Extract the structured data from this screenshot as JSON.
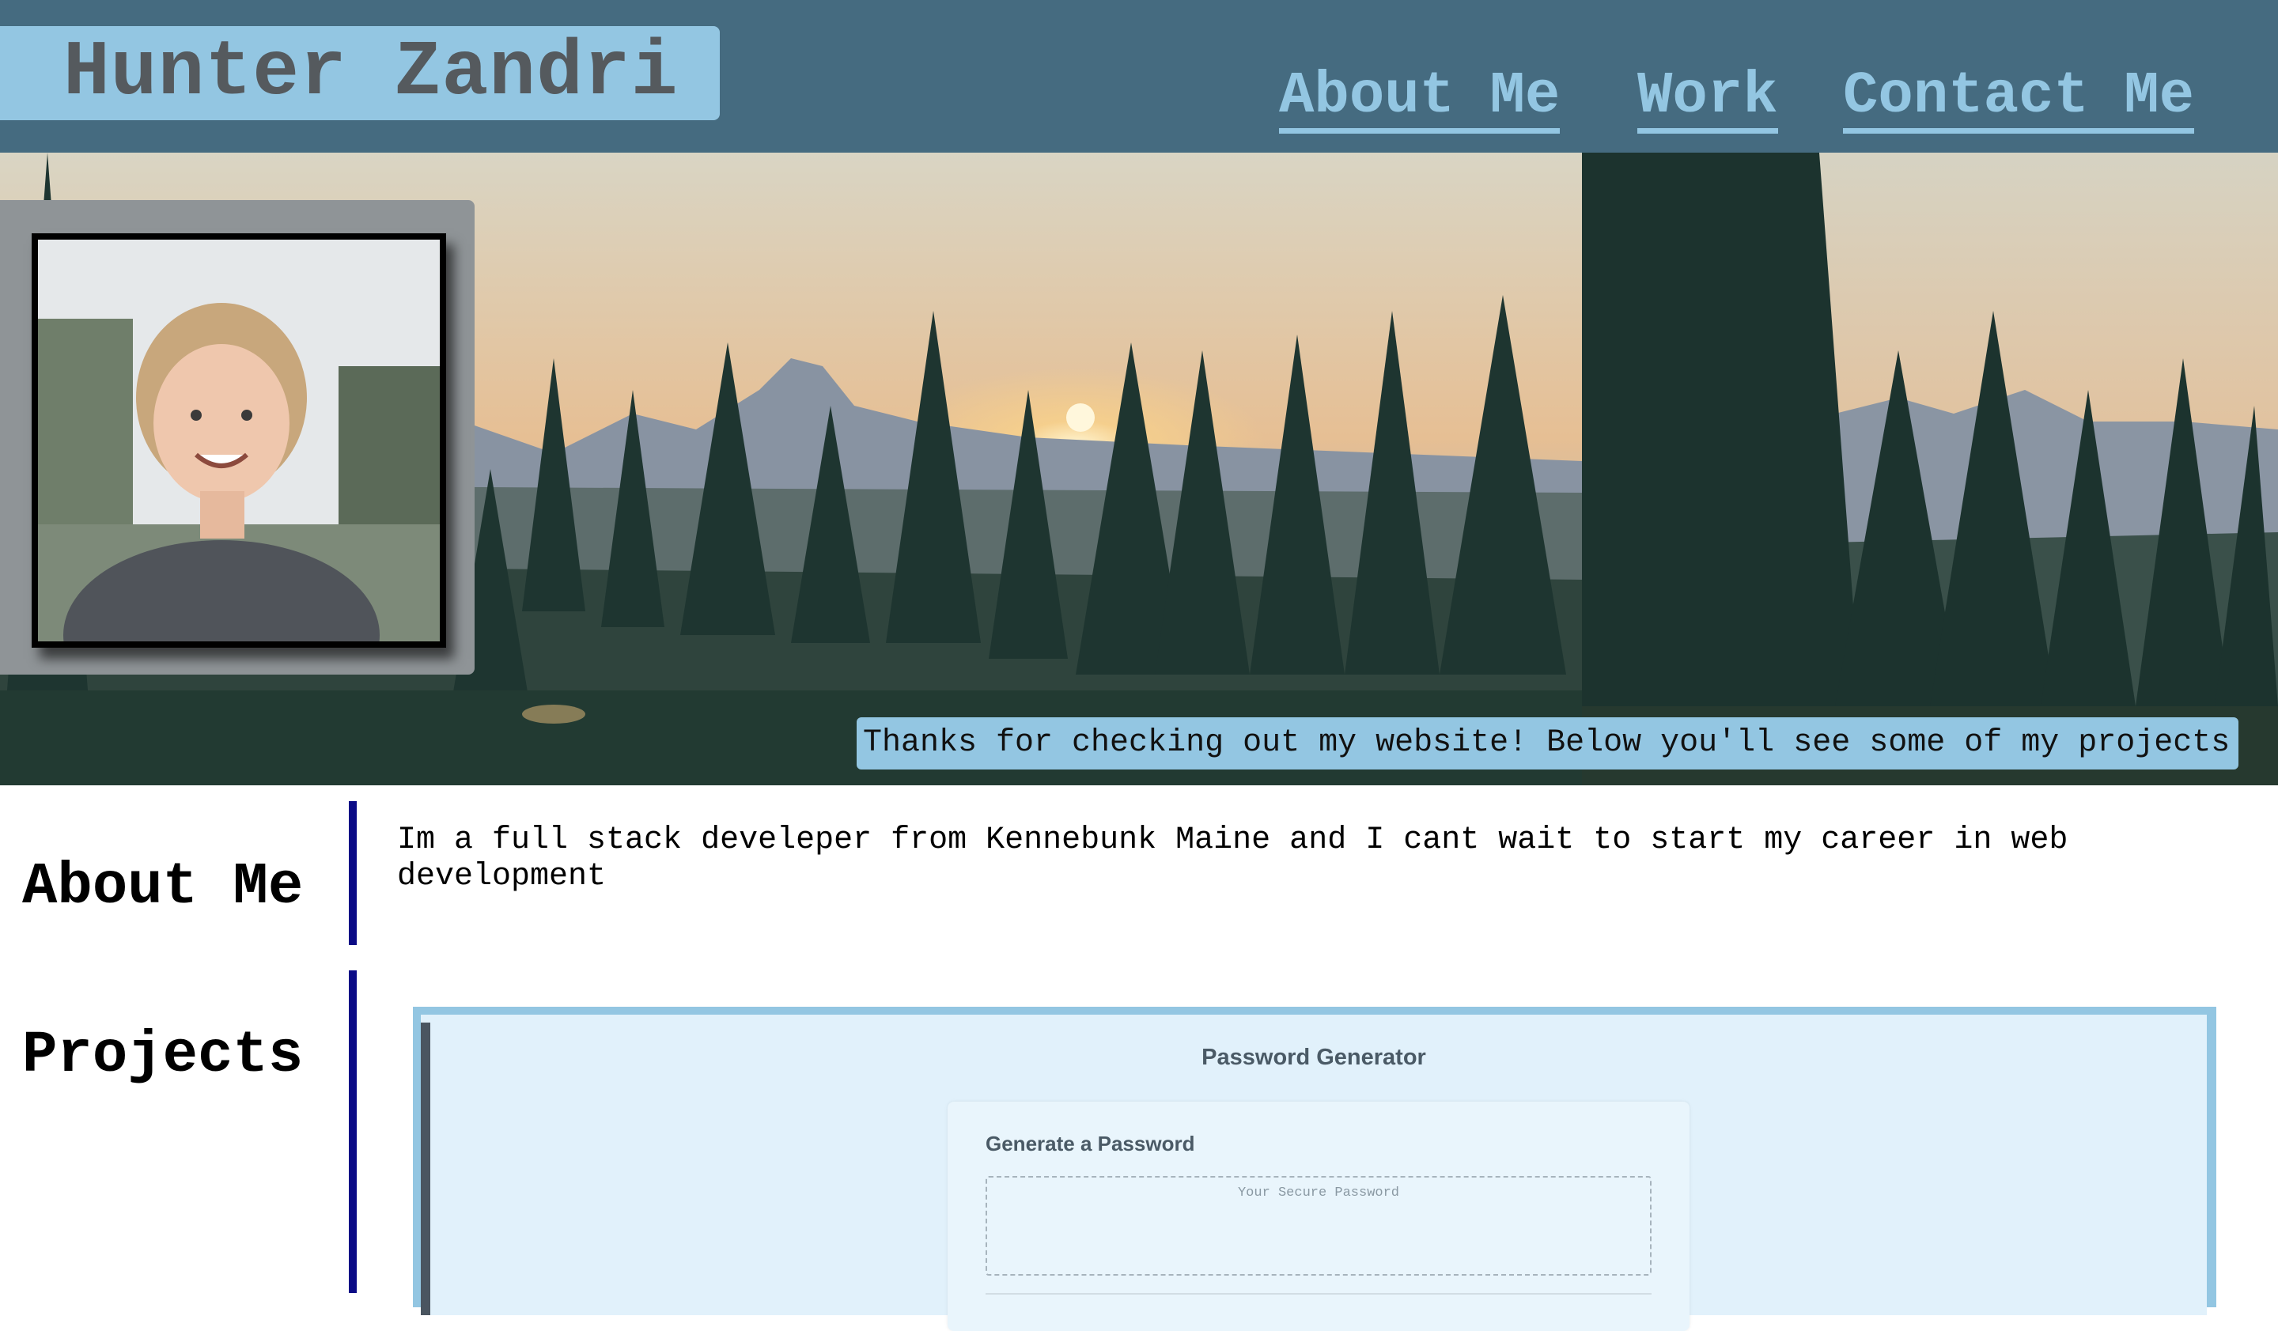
{
  "header": {
    "brand": "Hunter Zandri",
    "nav": [
      {
        "label": "About Me"
      },
      {
        "label": "Work"
      },
      {
        "label": "Contact Me"
      }
    ]
  },
  "hero": {
    "tagline": "Thanks for checking out my website! Below you'll see some of my projects"
  },
  "about": {
    "title": "About Me",
    "text": "Im a full stack develeper from Kennebunk Maine and I cant wait to start my career in web development"
  },
  "projects": {
    "title": "Projects",
    "items": [
      {
        "app_title": "Password Generator",
        "card_title": "Generate a Password",
        "placeholder": "Your Secure Password"
      }
    ]
  },
  "colors": {
    "header_bg": "#456b80",
    "accent": "#93c6e2",
    "brand_text": "#555a5e",
    "section_bar": "#0b0b86"
  },
  "icons": [
    "portrait-photo",
    "landscape-photo"
  ]
}
